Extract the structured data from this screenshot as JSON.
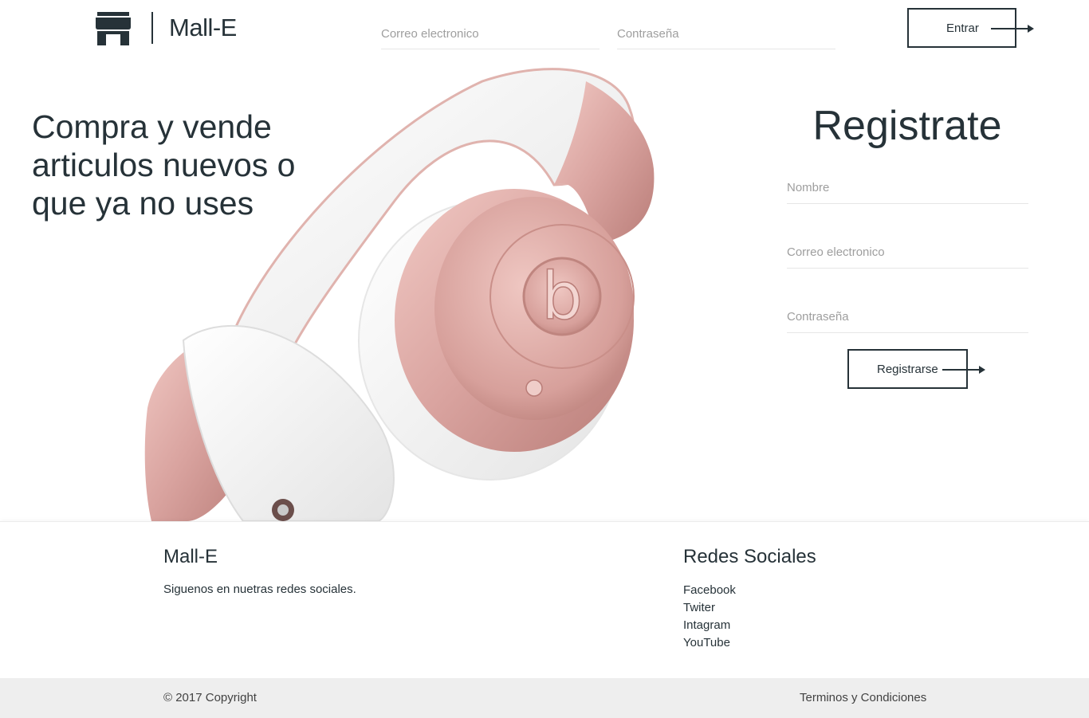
{
  "header": {
    "brand": "Mall-E",
    "email_placeholder": "Correo electronico",
    "password_placeholder": "Contraseña",
    "login_button": "Entrar"
  },
  "hero": {
    "headline": "Compra y vende articulos nuevos o que ya no uses"
  },
  "register": {
    "title": "Registrate",
    "name_placeholder": "Nombre",
    "email_placeholder": "Correo electronico",
    "password_placeholder": "Contraseña",
    "submit_button": "Registrarse"
  },
  "footer": {
    "brand_title": "Mall-E",
    "description": "Siguenos en nuetras redes sociales.",
    "social_title": "Redes Sociales",
    "social_links": [
      "Facebook",
      "Twiter",
      "Intagram",
      "YouTube"
    ],
    "copyright": "© 2017 Copyright",
    "terms": "Terminos y Condiciones"
  },
  "colors": {
    "text": "#263238",
    "bottom_bar": "#eeeeee",
    "rose_gold": "#d9a39f"
  }
}
